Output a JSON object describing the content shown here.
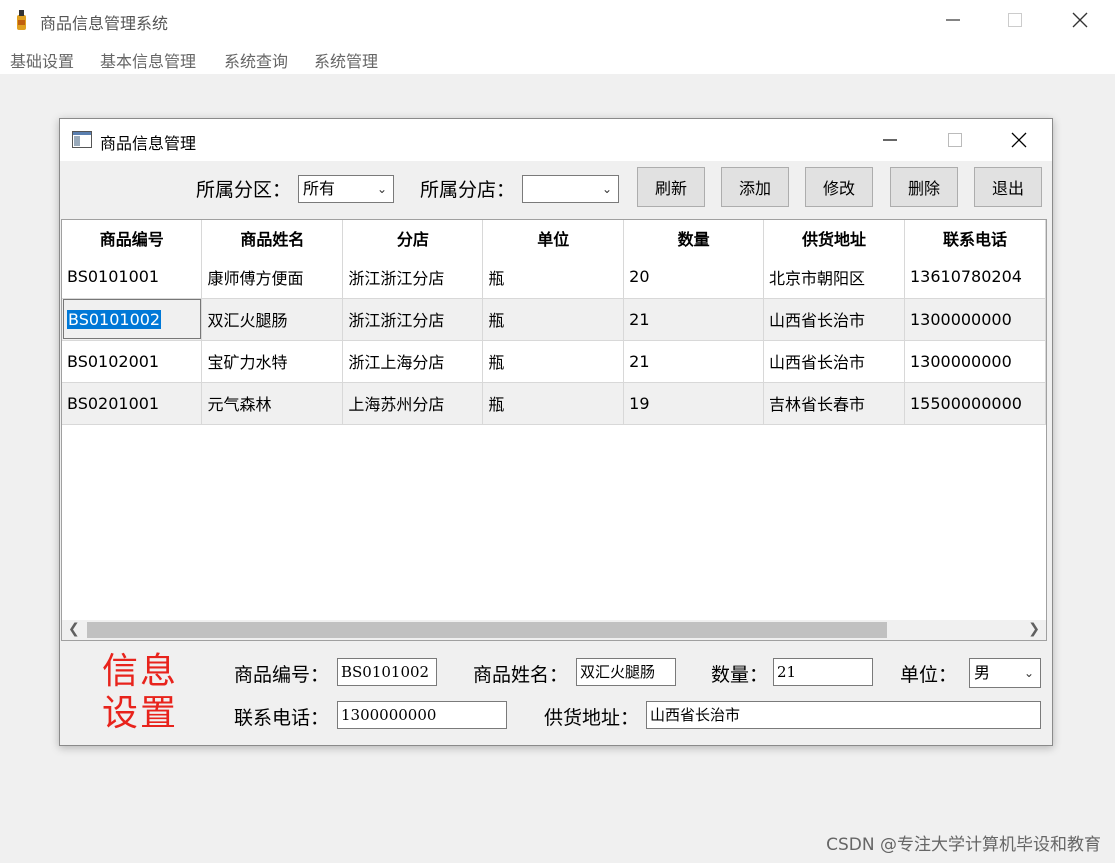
{
  "app": {
    "title": "商品信息管理系统",
    "menu": [
      "基础设置",
      "基本信息管理",
      "系统查询",
      "系统管理"
    ]
  },
  "dialog": {
    "title": "商品信息管理",
    "toolbar": {
      "zone_label": "所属分区：",
      "zone_value": "所有",
      "store_label": "所属分店：",
      "store_value": "",
      "buttons": [
        "刷新",
        "添加",
        "修改",
        "删除",
        "退出"
      ]
    },
    "grid": {
      "columns": [
        "商品编号",
        "商品姓名",
        "分店",
        "单位",
        "数量",
        "供货地址",
        "联系电话"
      ],
      "rows": [
        [
          "BS0101001",
          "康师傅方便面",
          "浙江浙江分店",
          "瓶",
          "20",
          "北京市朝阳区",
          "13610780204"
        ],
        [
          "BS0101002",
          "双汇火腿肠",
          "浙江浙江分店",
          "瓶",
          "21",
          "山西省长治市",
          "1300000000"
        ],
        [
          "BS0102001",
          "宝矿力水特",
          "浙江上海分店",
          "瓶",
          "21",
          "山西省长治市",
          "1300000000"
        ],
        [
          "BS0201001",
          "元气森林",
          "上海苏州分店",
          "瓶",
          "19",
          "吉林省长春市",
          "15500000000"
        ]
      ]
    },
    "info": {
      "logo_line1": "信息",
      "logo_line2": "设置",
      "code_label": "商品编号：",
      "code_value": "BS0101002",
      "name_label": "商品姓名：",
      "name_value": "双汇火腿肠",
      "qty_label": "数量：",
      "qty_value": "21",
      "unit_label": "单位：",
      "unit_value": "男",
      "phone_label": "联系电话：",
      "phone_value": "1300000000",
      "addr_label": "供货地址：",
      "addr_value": "山西省长治市"
    }
  },
  "watermark": "CSDN @专注大学计算机毕设和教育"
}
